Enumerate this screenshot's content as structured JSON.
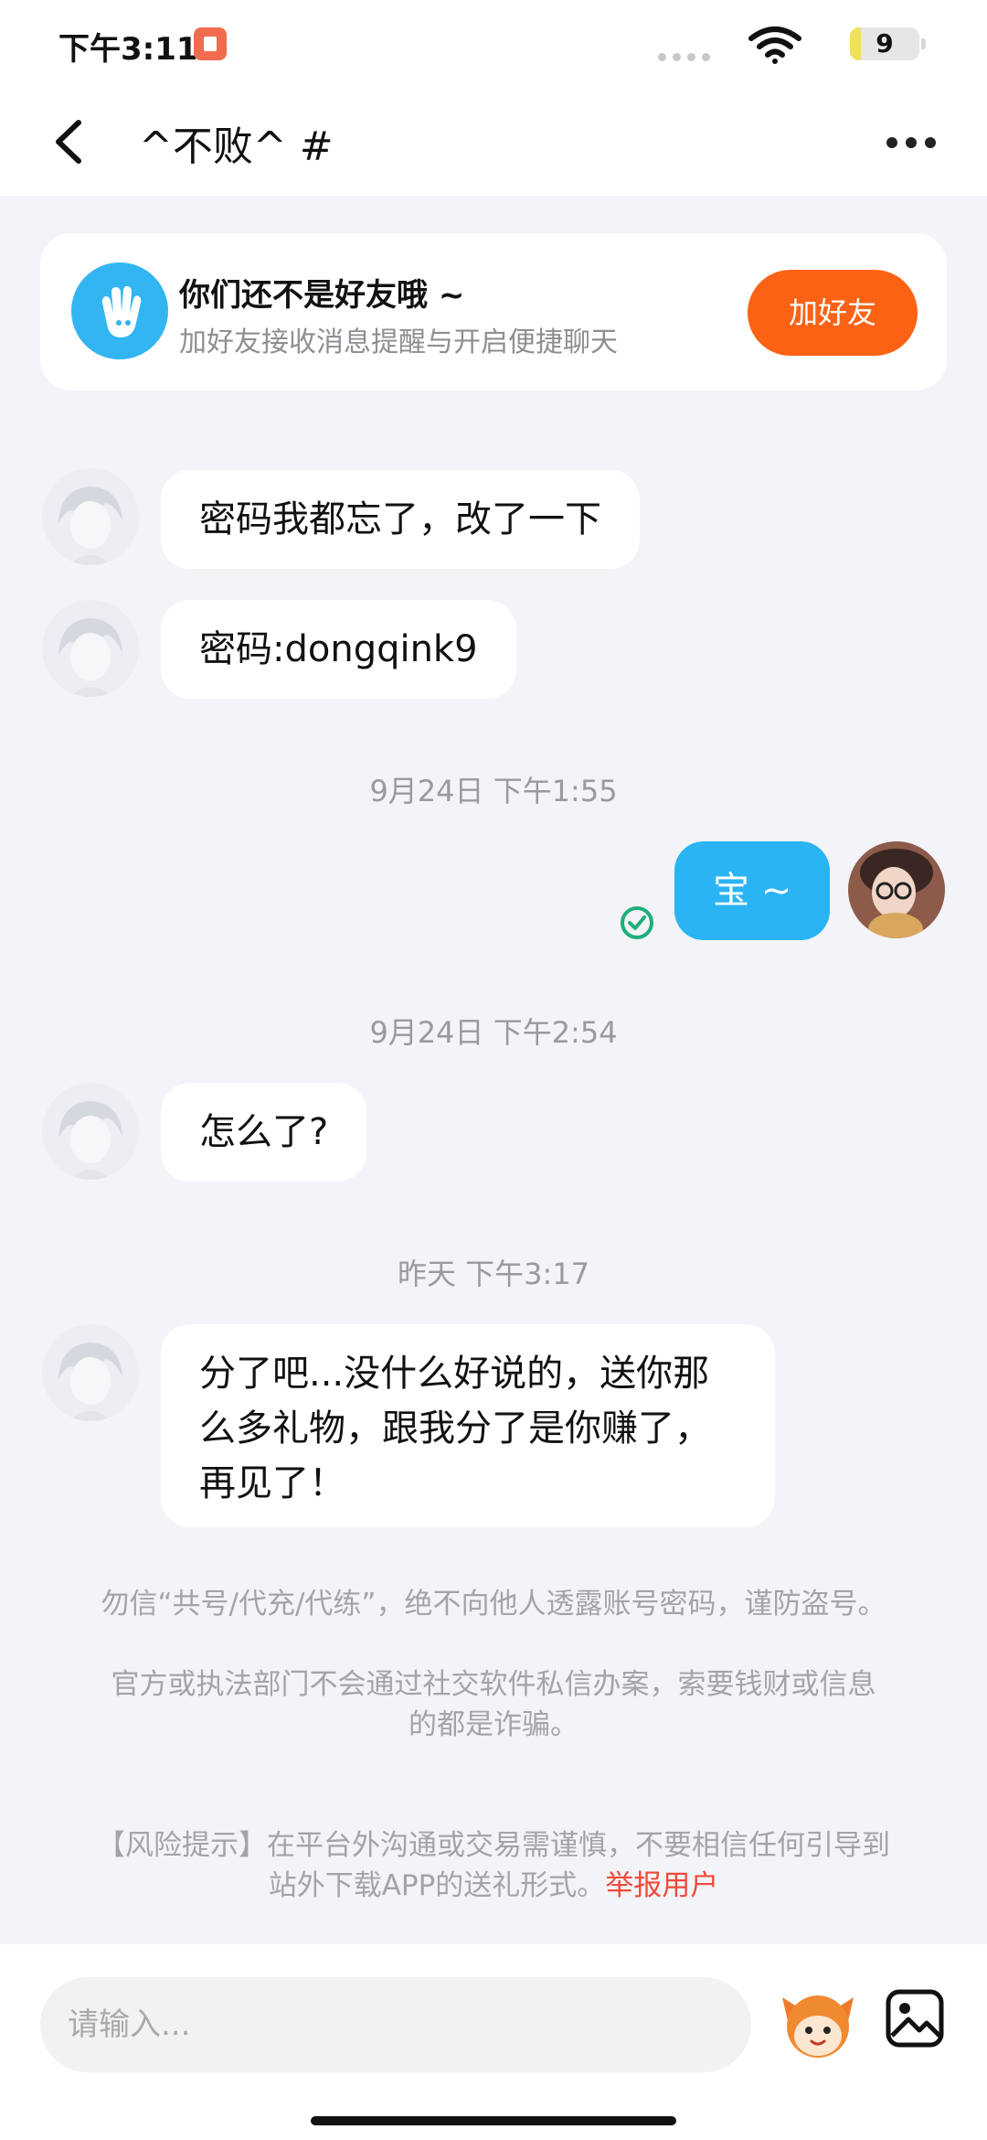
{
  "status_bar": {
    "time": "下午3:11",
    "battery": "9",
    "battery_level": 0.09,
    "icons": [
      "notification-icon",
      "wifi-icon",
      "battery-icon"
    ]
  },
  "header": {
    "title": "^不败^ #",
    "back_icon": "chevron-left-icon",
    "more_icon": "more-dots-icon"
  },
  "friend_card": {
    "title": "你们还不是好友哦 ~",
    "subtitle": "加好友接收消息提醒与开启便捷聊天",
    "button": "加好友",
    "icon": "wave-hand-icon"
  },
  "messages": [
    {
      "from": "other",
      "text": "密码我都忘了，改了一下"
    },
    {
      "from": "other",
      "text": "密码:dongqink9"
    },
    {
      "type": "time",
      "text": "9月24日 下午1:55"
    },
    {
      "from": "me",
      "text": "宝 ~",
      "status_icon": "sent-check-icon"
    },
    {
      "type": "time",
      "text": "9月24日 下午2:54"
    },
    {
      "from": "other",
      "text": "怎么了?"
    },
    {
      "type": "time",
      "text": "昨天 下午3:17"
    },
    {
      "from": "other",
      "lines": [
        "分了吧...没什么好说的，送你那",
        "么多礼物，跟我分了是你赚了，",
        "再见了！"
      ]
    }
  ],
  "notices": {
    "line1": "勿信“共号/代充/代练”，绝不向他人透露账号密码，谨防盗号。",
    "line2a": "官方或执法部门不会通过社交软件私信办案，索要钱财或信息",
    "line2b": "的都是诈骗。",
    "risk_a": "【风险提示】在平台外沟通或交易需谨慎，不要相信任何引导到",
    "risk_b": "站外下载APP的送礼形式。",
    "report": "举报用户"
  },
  "input": {
    "placeholder": "请输入...",
    "emoji_icon": "mascot-emoji-icon",
    "image_icon": "image-icon"
  },
  "colors": {
    "accent_blue": "#2ab4f3",
    "add_button": "#fb6213",
    "report_red": "#f04a3a",
    "background": "#f3f4f8"
  }
}
